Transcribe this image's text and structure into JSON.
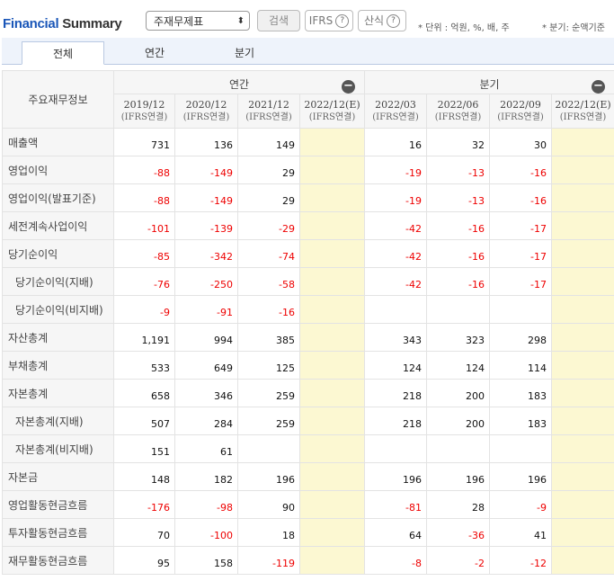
{
  "brand": {
    "part1": "Financial",
    "part2": " Summary"
  },
  "toolbar": {
    "select_value": "주재무제표",
    "search_label": "검색",
    "ifrs_label": "IFRS",
    "calc_label": "산식",
    "help_glyph": "?",
    "note_unit": "* 단위 : 억원, %, 배, 주",
    "note_quarter": "* 분기: 순액기준"
  },
  "tabs": [
    "전체",
    "연간",
    "분기"
  ],
  "table": {
    "corner_label": "주요재무정보",
    "group_annual": "연간",
    "group_quarter": "분기",
    "collapse_glyph": "−",
    "periods": [
      {
        "date": "2019/12",
        "basis": "(IFRS연결)"
      },
      {
        "date": "2020/12",
        "basis": "(IFRS연결)"
      },
      {
        "date": "2021/12",
        "basis": "(IFRS연결)"
      },
      {
        "date": "2022/12(E)",
        "basis": "(IFRS연결)"
      },
      {
        "date": "2022/03",
        "basis": "(IFRS연결)"
      },
      {
        "date": "2022/06",
        "basis": "(IFRS연결)"
      },
      {
        "date": "2022/09",
        "basis": "(IFRS연결)"
      },
      {
        "date": "2022/12(E)",
        "basis": "(IFRS연결)"
      }
    ],
    "rows": [
      {
        "label": "매출액",
        "indent": false,
        "values": [
          "731",
          "136",
          "149",
          "",
          "16",
          "32",
          "30",
          ""
        ]
      },
      {
        "label": "영업이익",
        "indent": false,
        "values": [
          "-88",
          "-149",
          "29",
          "",
          "-19",
          "-13",
          "-16",
          ""
        ]
      },
      {
        "label": "영업이익(발표기준)",
        "indent": false,
        "values": [
          "-88",
          "-149",
          "29",
          "",
          "-19",
          "-13",
          "-16",
          ""
        ]
      },
      {
        "label": "세전계속사업이익",
        "indent": false,
        "values": [
          "-101",
          "-139",
          "-29",
          "",
          "-42",
          "-16",
          "-17",
          ""
        ]
      },
      {
        "label": "당기순이익",
        "indent": false,
        "values": [
          "-85",
          "-342",
          "-74",
          "",
          "-42",
          "-16",
          "-17",
          ""
        ]
      },
      {
        "label": "당기순이익(지배)",
        "indent": true,
        "values": [
          "-76",
          "-250",
          "-58",
          "",
          "-42",
          "-16",
          "-17",
          ""
        ]
      },
      {
        "label": "당기순이익(비지배)",
        "indent": true,
        "values": [
          "-9",
          "-91",
          "-16",
          "",
          "",
          "",
          "",
          ""
        ]
      },
      {
        "label": "자산총계",
        "indent": false,
        "values": [
          "1,191",
          "994",
          "385",
          "",
          "343",
          "323",
          "298",
          ""
        ]
      },
      {
        "label": "부채총계",
        "indent": false,
        "values": [
          "533",
          "649",
          "125",
          "",
          "124",
          "124",
          "114",
          ""
        ]
      },
      {
        "label": "자본총계",
        "indent": false,
        "values": [
          "658",
          "346",
          "259",
          "",
          "218",
          "200",
          "183",
          ""
        ]
      },
      {
        "label": "자본총계(지배)",
        "indent": true,
        "values": [
          "507",
          "284",
          "259",
          "",
          "218",
          "200",
          "183",
          ""
        ]
      },
      {
        "label": "자본총계(비지배)",
        "indent": true,
        "values": [
          "151",
          "61",
          "",
          "",
          "",
          "",
          "",
          ""
        ]
      },
      {
        "label": "자본금",
        "indent": false,
        "values": [
          "148",
          "182",
          "196",
          "",
          "196",
          "196",
          "196",
          ""
        ]
      },
      {
        "label": "영업활동현금흐름",
        "indent": false,
        "values": [
          "-176",
          "-98",
          "90",
          "",
          "-81",
          "28",
          "-9",
          ""
        ]
      },
      {
        "label": "투자활동현금흐름",
        "indent": false,
        "values": [
          "70",
          "-100",
          "18",
          "",
          "64",
          "-36",
          "41",
          ""
        ]
      },
      {
        "label": "재무활동현금흐름",
        "indent": false,
        "values": [
          "95",
          "158",
          "-119",
          "",
          "-8",
          "-2",
          "-12",
          ""
        ]
      }
    ]
  },
  "colors": {
    "brand_blue": "#1a56b8",
    "negative": "#e00000",
    "estimate_bg": "#fcf8d2"
  }
}
